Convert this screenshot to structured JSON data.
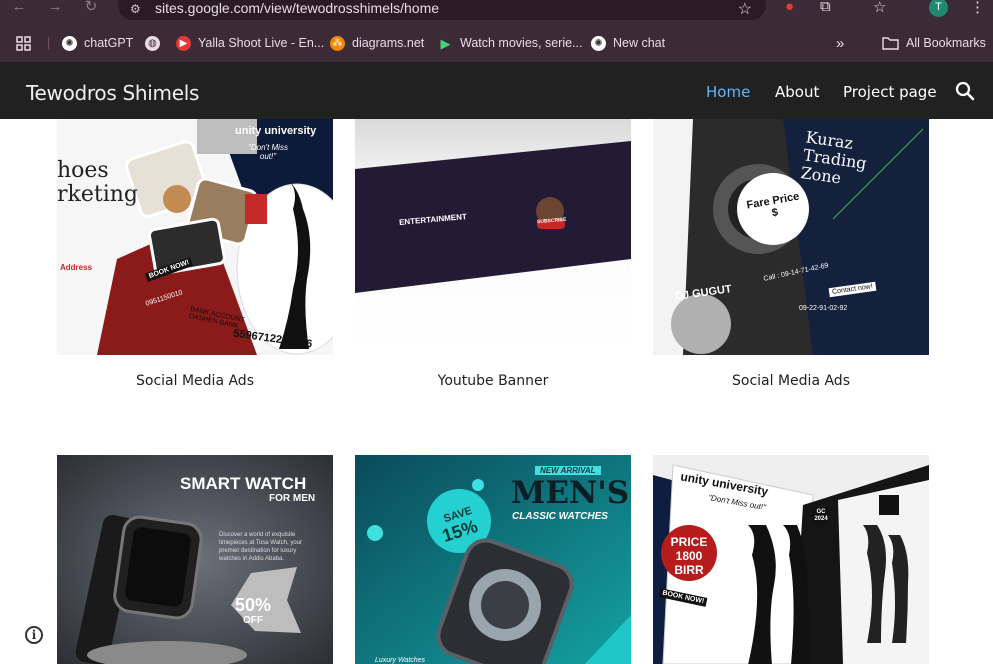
{
  "browser": {
    "url": "sites.google.com/view/tewodrosshimels/home",
    "profile_initial": "T",
    "bookmarks": [
      {
        "label": "chatGPT",
        "icon": "openai-icon"
      },
      {
        "label": "",
        "icon": "globe-icon"
      },
      {
        "label": "Yalla Shoot Live - En...",
        "icon": "play-red-icon"
      },
      {
        "label": "diagrams.net",
        "icon": "diagrams-icon"
      },
      {
        "label": "Watch movies, serie...",
        "icon": "play-green-icon"
      },
      {
        "label": "New chat",
        "icon": "openai-icon"
      }
    ],
    "all_bookmarks": "All Bookmarks",
    "more_bookmarks": "»"
  },
  "site": {
    "title": "Tewodros Shimels",
    "nav": [
      {
        "label": "Home",
        "active": true
      },
      {
        "label": "About",
        "active": false
      },
      {
        "label": "Project page",
        "active": false
      }
    ]
  },
  "gallery": {
    "row1": [
      {
        "caption": "Social Media Ads"
      },
      {
        "caption": "Youtube Banner"
      },
      {
        "caption": "Social Media Ads"
      }
    ],
    "tile_text": {
      "shoes_brand": "unity university",
      "shoes_dontmiss": "\"Don't Miss out!\"",
      "shoes_book": "BOOK NOW!",
      "shoes_phone": "0951150010",
      "shoes_bank": "BANK ACCOUNT DASHEN BANK",
      "shoes_account": "5596712261016",
      "shoes_address": "Address",
      "shoes_heading": "hoes rketing",
      "banner_brand": "ENTERTAINMENT",
      "banner_sub": "SUBSCRIBE",
      "dj_kuraz": "Kuraz Trading Zone",
      "dj_fare": "Fare Price $",
      "dj_name": "DJ GUGUT",
      "dj_call": "Call : 09-14-71-42-69",
      "dj_contact": "Contact now!",
      "dj_phone": "09-22-91-02-92",
      "watch_title": "SMART WATCH",
      "watch_for": "FOR MEN",
      "watch_desc": "Discover a world of exquisite timepieces at Tosa Watch, your premier destination for luxury watches in Addis Ababa.",
      "watch_off": "50%",
      "watch_off2": "OFF",
      "mens_new": "NEW ARRIVAL",
      "mens_title": "MEN'S",
      "mens_sub": "CLASSIC WATCHES",
      "mens_save": "SAVE",
      "mens_pct": "15%",
      "mens_luxury": "Luxury Watches",
      "uni_brand": "unity university",
      "uni_dontmiss": "\"Don't Miss out!\"",
      "uni_price": "PRICE",
      "uni_amount": "1800",
      "uni_birr": "BIRR",
      "uni_book": "BOOK NOW!",
      "uni_gc": "GC 2024"
    }
  },
  "colors": {
    "header_bg": "#212121",
    "nav_active": "#64b5f6",
    "chrome_bg": "#3c2a36"
  }
}
